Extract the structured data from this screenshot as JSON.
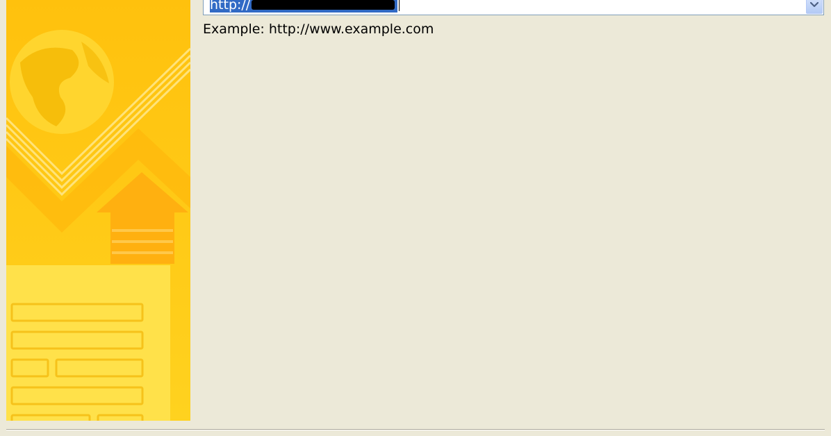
{
  "url_field": {
    "value_prefix": "http://",
    "redacted": true
  },
  "example_hint": "Example: http://www.example.com",
  "icons": {
    "dropdown": "chevron-down-icon",
    "banner": "globe-upload-banner"
  },
  "colors": {
    "dialog_background": "#ECE9D8",
    "selection_highlight": "#316AC5",
    "banner_primary": "#FFC20E",
    "banner_light": "#FFE14A"
  }
}
